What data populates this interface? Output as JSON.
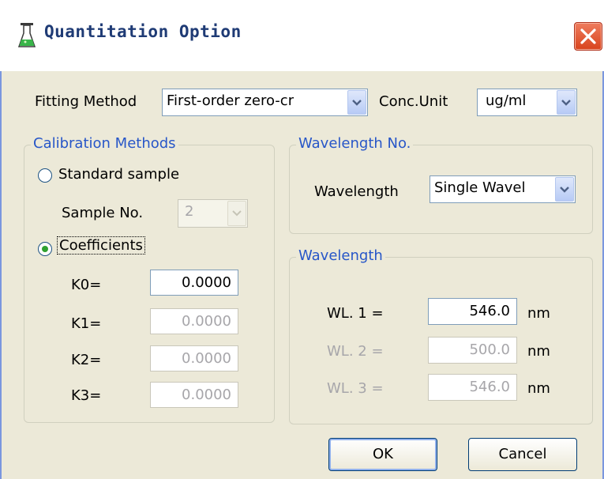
{
  "window": {
    "title": "Quantitation Option"
  },
  "fitting": {
    "label": "Fitting Method",
    "value": "First-order zero-cr"
  },
  "conc": {
    "label": "Conc.Unit",
    "value": "ug/ml"
  },
  "calibration": {
    "title": "Calibration Methods",
    "standard_label": "Standard sample",
    "sample_no_label": "Sample No.",
    "sample_no_value": "2",
    "coefficients_label": "Coefficients",
    "selected": "coefficients",
    "k": [
      {
        "label": "K0=",
        "value": "0.0000",
        "enabled": true
      },
      {
        "label": "K1=",
        "value": "0.0000",
        "enabled": false
      },
      {
        "label": "K2=",
        "value": "0.0000",
        "enabled": false
      },
      {
        "label": "K3=",
        "value": "0.0000",
        "enabled": false
      }
    ]
  },
  "wavelength_no": {
    "title": "Wavelength No.",
    "label": "Wavelength",
    "value": "Single Wavel"
  },
  "wavelength": {
    "title": "Wavelength",
    "rows": [
      {
        "label": "WL. 1 =",
        "value": "546.0",
        "unit": "nm",
        "enabled": true
      },
      {
        "label": "WL. 2 =",
        "value": "500.0",
        "unit": "nm",
        "enabled": false
      },
      {
        "label": "WL. 3 =",
        "value": "546.0",
        "unit": "nm",
        "enabled": false
      }
    ]
  },
  "buttons": {
    "ok": "OK",
    "cancel": "Cancel"
  },
  "colors": {
    "group_title": "#2756c8",
    "title_text": "#1f3b75",
    "close_button": "#d8431c",
    "radio_dot": "#2fa12f"
  },
  "icons": {
    "app": "flask-icon",
    "close": "close-icon",
    "dropdown": "chevron-down-icon"
  }
}
